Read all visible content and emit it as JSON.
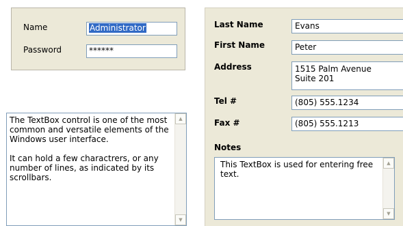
{
  "login": {
    "name_label": "Name",
    "name_value": "Administrator",
    "password_label": "Password",
    "password_value": "******"
  },
  "info_textbox": {
    "paragraph1": "The TextBox control is one of the most common and versatile elements of the Windows user interface.",
    "paragraph2": "It can hold a few charactrers, or any number of lines, as indicated by its scrollbars."
  },
  "contact": {
    "last_name_label": "Last Name",
    "last_name_value": "Evans",
    "first_name_label": "First Name",
    "first_name_value": "Peter",
    "address_label": "Address",
    "address_line1": "1515 Palm Avenue",
    "address_line2": "Suite 201",
    "tel_label": "Tel #",
    "tel_value": "(805) 555.1234",
    "fax_label": "Fax #",
    "fax_value": "(805) 555.1213",
    "notes_label": "Notes",
    "notes_value": "This TextBox is used for entering free text."
  },
  "icons": {
    "scroll_up": "scroll-up-arrow",
    "scroll_down": "scroll-down-arrow"
  }
}
